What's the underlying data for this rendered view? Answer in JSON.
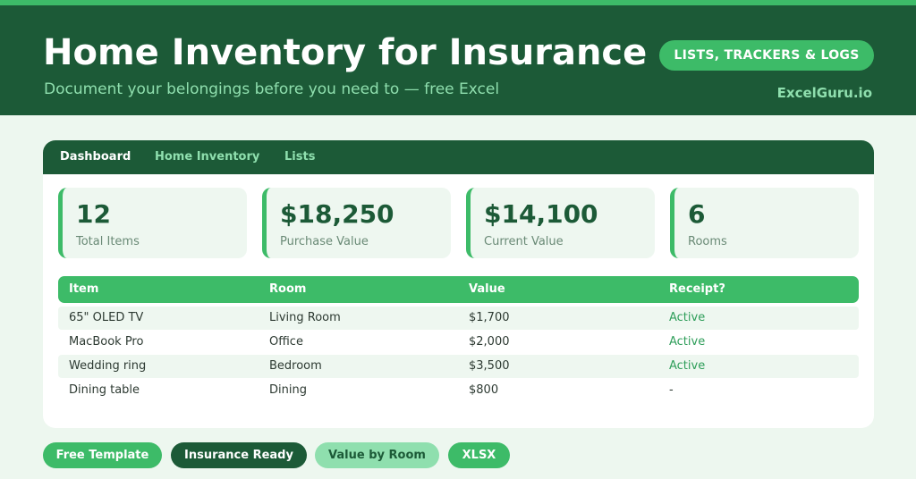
{
  "header": {
    "title": "Home Inventory for Insurance",
    "subtitle": "Document your belongings before you need to — free Excel",
    "category_pill": "LISTS, TRACKERS & LOGS",
    "brand": "ExcelGuru.io"
  },
  "tabs": [
    "Dashboard",
    "Home Inventory",
    "Lists"
  ],
  "active_tab": "Dashboard",
  "stats": [
    {
      "value": "12",
      "label": "Total Items"
    },
    {
      "value": "$18,250",
      "label": "Purchase Value"
    },
    {
      "value": "$14,100",
      "label": "Current Value"
    },
    {
      "value": "6",
      "label": "Rooms"
    }
  ],
  "table": {
    "columns": [
      "Item",
      "Room",
      "Value",
      "Receipt?"
    ],
    "rows": [
      {
        "item": "65\" OLED TV",
        "room": "Living Room",
        "value": "$1,700",
        "receipt": "Active"
      },
      {
        "item": "MacBook Pro",
        "room": "Office",
        "value": "$2,000",
        "receipt": "Active"
      },
      {
        "item": "Wedding ring",
        "room": "Bedroom",
        "value": "$3,500",
        "receipt": "Active"
      },
      {
        "item": "Dining table",
        "room": "Dining",
        "value": "$800",
        "receipt": "-"
      }
    ]
  },
  "tags": [
    "Free Template",
    "Insurance Ready",
    "Value by Room",
    "XLSX"
  ],
  "colors": {
    "dark_green": "#1c5a37",
    "accent_green": "#3dbb68",
    "light_green": "#8fdfae",
    "background": "#edf7ef"
  }
}
